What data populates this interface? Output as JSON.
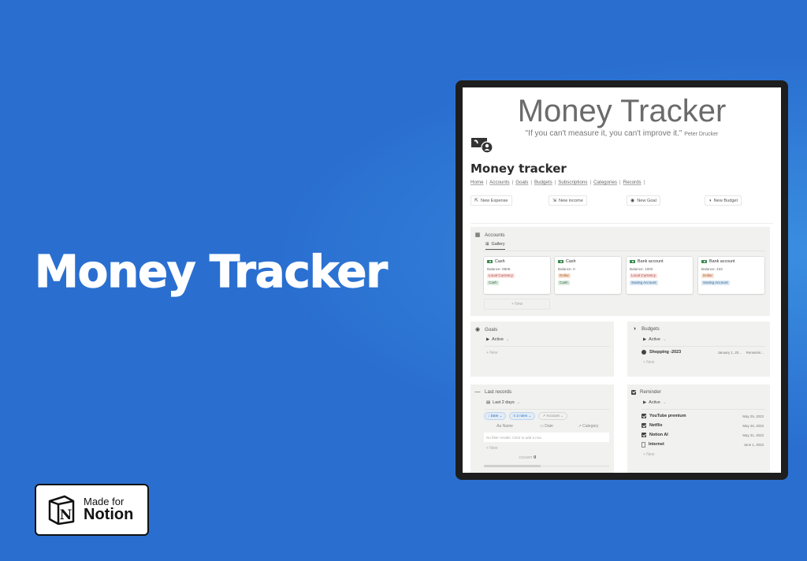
{
  "hero": {
    "title": "Money Tracker"
  },
  "badge": {
    "line1": "Made for",
    "line2": "Notion",
    "logo_letter": "N"
  },
  "page": {
    "cover_title": "Money Tracker",
    "cover_quote": "\"If you can't measure it, you can't improve it.\"",
    "cover_quote_author": "Peter Drucker",
    "title": "Money tracker",
    "nav": [
      "Home",
      "Accounts",
      "Goals",
      "Budgets",
      "Subscriptions",
      "Categories",
      "Records"
    ],
    "buttons": [
      {
        "label": "New Expense",
        "icon": "arrow-up-left-icon",
        "glyph": "⇱"
      },
      {
        "label": "New income",
        "icon": "arrow-down-right-icon",
        "glyph": "⇲"
      },
      {
        "label": "New Goal",
        "icon": "goal-icon",
        "glyph": "◉"
      },
      {
        "label": "New Budget",
        "icon": "pie-icon",
        "glyph": "◑"
      }
    ]
  },
  "accounts": {
    "title": "Accounts",
    "view": "Gallery",
    "cards": [
      {
        "name": "Cash",
        "balance": "Balance: 9606",
        "currency": "Local Currency",
        "currency_color": "red",
        "type": "Cash",
        "type_color": "green"
      },
      {
        "name": "Cash",
        "balance": "Balance: 0",
        "currency": "Dollar",
        "currency_color": "orange",
        "type": "Cash",
        "type_color": "green"
      },
      {
        "name": "Bank account",
        "balance": "Balance: 1000",
        "currency": "Local Currency",
        "currency_color": "red",
        "type": "Saving Account",
        "type_color": "blue"
      },
      {
        "name": "Bank account",
        "balance": "Balance: 433",
        "currency": "Dollar",
        "currency_color": "orange",
        "type": "Saving Account",
        "type_color": "blue"
      }
    ],
    "new_label": "+ New"
  },
  "goals": {
    "title": "Goals",
    "view": "Active",
    "new_label": "+ New"
  },
  "budgets": {
    "title": "Budgets",
    "view": "Active",
    "items": [
      {
        "name": "Shopping -2023",
        "date": "January 1, 20...",
        "status": "Remainin..."
      }
    ],
    "new_label": "+ New"
  },
  "records": {
    "title": "Last records",
    "view": "Last 2 days",
    "filters": [
      "↓ Date ⌄",
      "≡ 2 rules ⌄",
      "↗ Account ⌄"
    ],
    "columns": [
      "Aa Name",
      "▭ Date",
      "↗ Category"
    ],
    "empty_text": "No filter results. Click to add a row.",
    "new_label": "+ New",
    "count_label": "COUNT",
    "count_value": "0"
  },
  "reminder": {
    "title": "Reminder",
    "view": "Active",
    "items": [
      {
        "name": "YouTube premium",
        "date": "May 25, 2023",
        "icon": "checkbox"
      },
      {
        "name": "Netflix",
        "date": "May 26, 2023",
        "icon": "checkbox"
      },
      {
        "name": "Notion AI",
        "date": "May 31, 2023",
        "icon": "checkbox"
      },
      {
        "name": "Internet",
        "date": "June 1, 2023",
        "icon": "doc"
      }
    ],
    "new_label": "+ New"
  },
  "colors": {
    "background": "#2a6fd0",
    "frame": "#1e1e1e",
    "panel": "#f1f1ef"
  }
}
